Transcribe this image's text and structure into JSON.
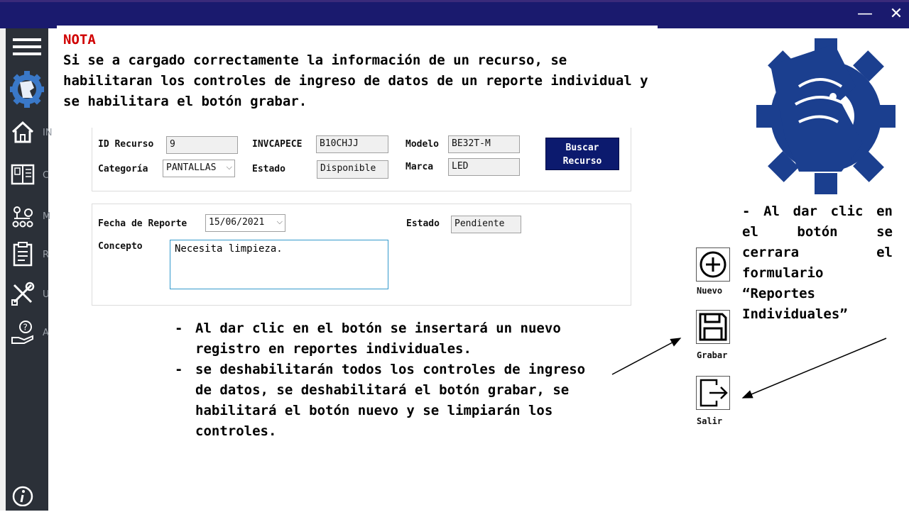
{
  "window": {
    "minimize_glyph": "—",
    "close_glyph": "✕"
  },
  "sidebar": {
    "items": [
      {
        "icon": "home-icon",
        "letter": "IN"
      },
      {
        "icon": "book-icon",
        "letter": "C"
      },
      {
        "icon": "network-icon",
        "letter": "M"
      },
      {
        "icon": "clipboard-icon",
        "letter": "R"
      },
      {
        "icon": "tools-icon",
        "letter": "U"
      },
      {
        "icon": "help-hand-icon",
        "letter": "A"
      }
    ]
  },
  "nota": {
    "title": "NOTA",
    "text": "Si se a cargado correctamente la información de un recurso, se habilitaran los controles de ingreso de datos de un reporte individual y se habilitara el botón grabar."
  },
  "resource": {
    "id_label": "ID Recurso",
    "id_value": "9",
    "invcapece_label": "INVCAPECE",
    "invcapece_value": "B10CHJJ",
    "modelo_label": "Modelo",
    "modelo_value": "BE32T-M",
    "categoria_label": "Categoría",
    "categoria_value": "PANTALLAS",
    "estado_label": "Estado",
    "estado_value": "Disponible",
    "marca_label": "Marca",
    "marca_value": "LED",
    "buscar_label": "Buscar Recurso"
  },
  "report": {
    "fecha_label": "Fecha de Reporte",
    "fecha_value": "15/06/2021",
    "estado_label": "Estado",
    "estado_value": "Pendiente",
    "concepto_label": "Concepto",
    "concepto_value": "Necesita limpieza."
  },
  "bullets": {
    "dash": "-",
    "b1": "Al dar clic en el botón se insertará un nuevo registro en reportes individuales.",
    "b2": "se deshabilitarán todos los controles de ingreso de datos, se deshabilitará el botón grabar, se habilitará el botón nuevo y se limpiarán los controles."
  },
  "actions": {
    "nuevo": "Nuevo",
    "grabar": "Grabar",
    "salir": "Salir"
  },
  "right_note": "- Al dar clic en el botón se cerrara el formulario “Reportes Individuales”",
  "colors": {
    "titlebar": "#1a1a6e",
    "sidebar": "#2b3038",
    "nota_title": "#d00000",
    "buscar_button": "#0c1a6e",
    "logo": "#1b3f8f"
  }
}
